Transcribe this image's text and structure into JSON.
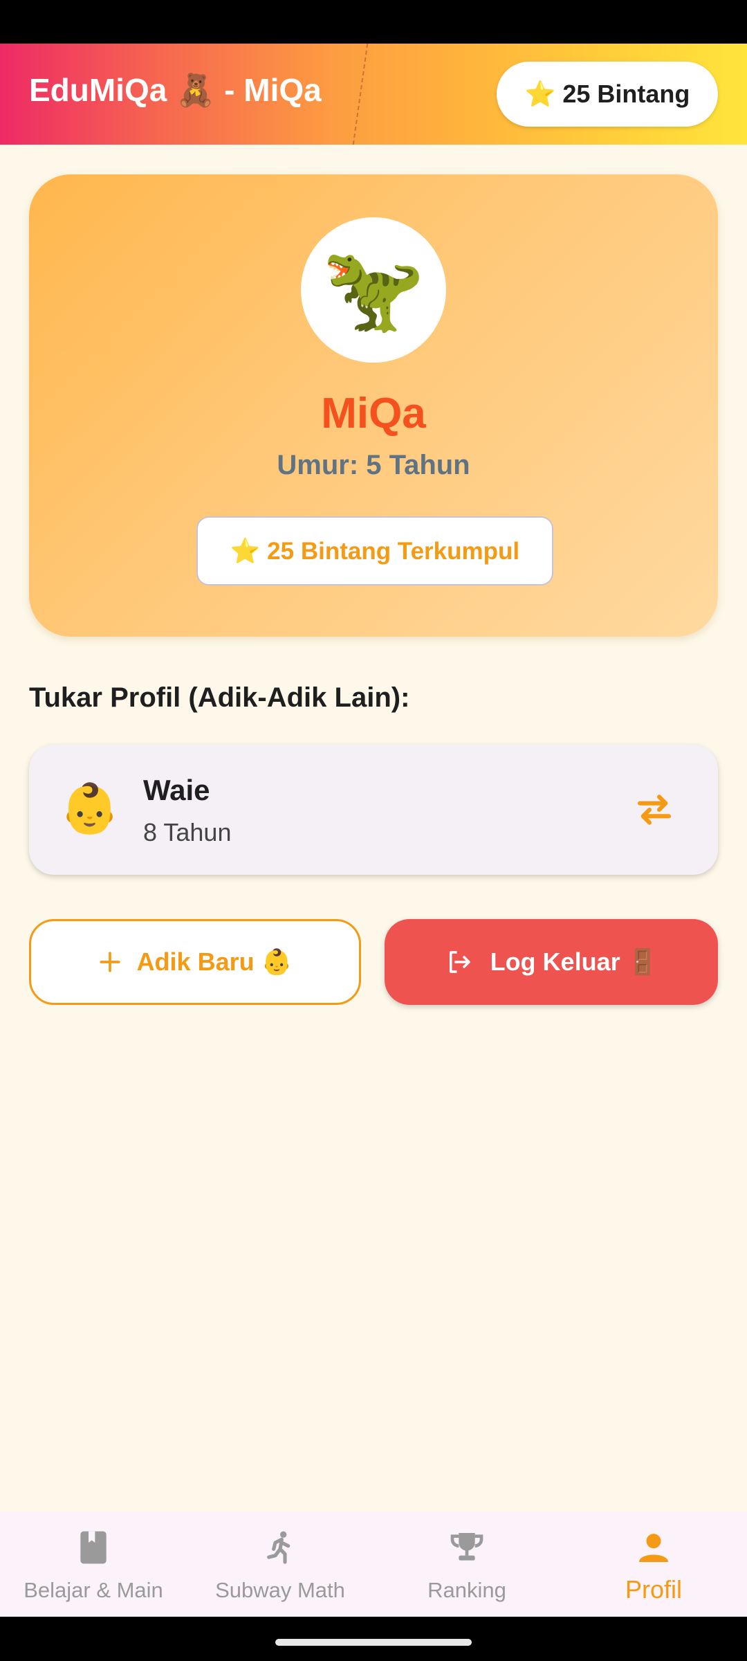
{
  "app_bar": {
    "title": "EduMiQa 🧸 - MiQa",
    "stars_badge": "⭐ 25 Bintang",
    "gradient_colors": [
      "#ee2a66",
      "#ffb73b",
      "#ffe53b"
    ]
  },
  "profile": {
    "avatar_emoji": "🦖",
    "name": "MiQa",
    "age": "Umur: 5 Tahun",
    "stars_collected": "⭐ 25 Bintang Terkumpul"
  },
  "switch_section": {
    "title": "Tukar Profil (Adik-Adik Lain):",
    "children": [
      {
        "emoji": "👶",
        "name": "Waie",
        "age": "8 Tahun",
        "action_icon": "swap-icon"
      }
    ]
  },
  "actions": {
    "add_label": "Adik Baru 👶",
    "add_icon": "plus-icon",
    "logout_label": "Log Keluar 🚪",
    "logout_icon": "logout-icon",
    "accent_color": "#f59a14",
    "logout_color": "#ef5350"
  },
  "bottom_nav": {
    "items": [
      {
        "label": "Belajar & Main",
        "icon": "book-icon"
      },
      {
        "label": "Subway Math",
        "icon": "runner-icon"
      },
      {
        "label": "Ranking",
        "icon": "trophy-icon"
      },
      {
        "label": "Profil",
        "icon": "person-icon",
        "active": true
      }
    ]
  }
}
